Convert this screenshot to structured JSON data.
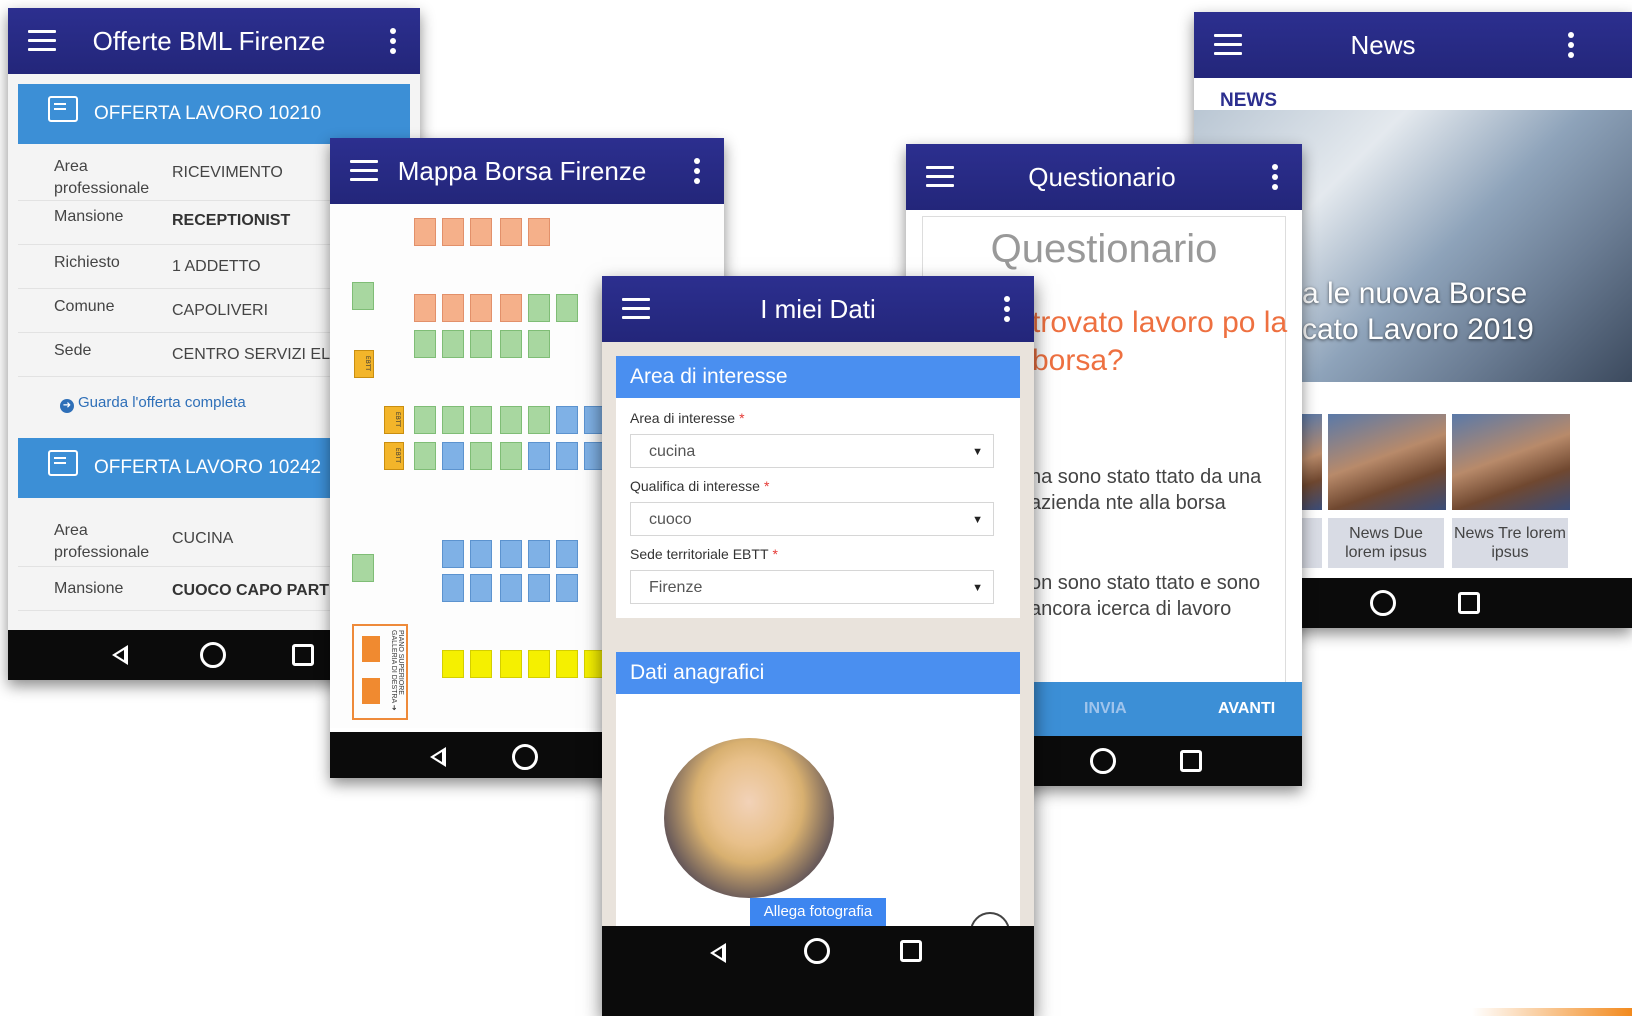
{
  "colors": {
    "appbar": "#2c2f8f",
    "accent_blue": "#3c8fd6",
    "question_orange": "#ee7040"
  },
  "offerte": {
    "title": "Offerte BML Firenze",
    "offers": [
      {
        "header": "OFFERTA LAVORO 10210",
        "rows": [
          {
            "key": "Area professionale",
            "value": "RICEVIMENTO"
          },
          {
            "key": "Mansione",
            "value": "RECEPTIONIST"
          },
          {
            "key": "Richiesto",
            "value": "1 ADDETTO"
          },
          {
            "key": "Comune",
            "value": "CAPOLIVERI"
          },
          {
            "key": "Sede",
            "value": "CENTRO SERVIZI ELE"
          }
        ],
        "link": "Guarda l'offerta completa"
      },
      {
        "header": "OFFERTA LAVORO 10242",
        "rows": [
          {
            "key": "Area professionale",
            "value": "CUCINA"
          },
          {
            "key": "Mansione",
            "value": "CUOCO CAPO PART"
          }
        ]
      }
    ]
  },
  "mappa": {
    "title": "Mappa Borsa Firenze",
    "stairs_label": "PIANO SUPERIORE GALLERIA DI DESTRA ➜",
    "ebtt_label": "EBTT"
  },
  "dati": {
    "title": "I miei Dati",
    "section_interest": "Area di interesse",
    "fields": [
      {
        "label": "Area di interesse",
        "value": "cucina"
      },
      {
        "label": "Qualifica di interesse",
        "value": "cuoco"
      },
      {
        "label": "Sede territoriale EBTT",
        "value": "Firenze"
      }
    ],
    "required_mark": "*",
    "section_personal": "Dati anagrafici",
    "attach_photo": "Allega fotografia"
  },
  "questionario": {
    "title": "Questionario",
    "heading": "Questionario",
    "question": "trovato lavoro po la borsa?",
    "option1": "na sono stato ttato da una azienda nte alla borsa",
    "option2": "on sono stato ttato e sono ancora icerca di lavoro",
    "btn_send": "INVIA",
    "btn_next": "AVANTI"
  },
  "news": {
    "title": "News",
    "label": "NEWS",
    "hero_line1": "a le nuova Borse",
    "hero_line2": "cato Lavoro 2019",
    "items": [
      {
        "caption": "News Due lorem ipsus"
      },
      {
        "caption": "News Tre lorem ipsus"
      }
    ]
  }
}
